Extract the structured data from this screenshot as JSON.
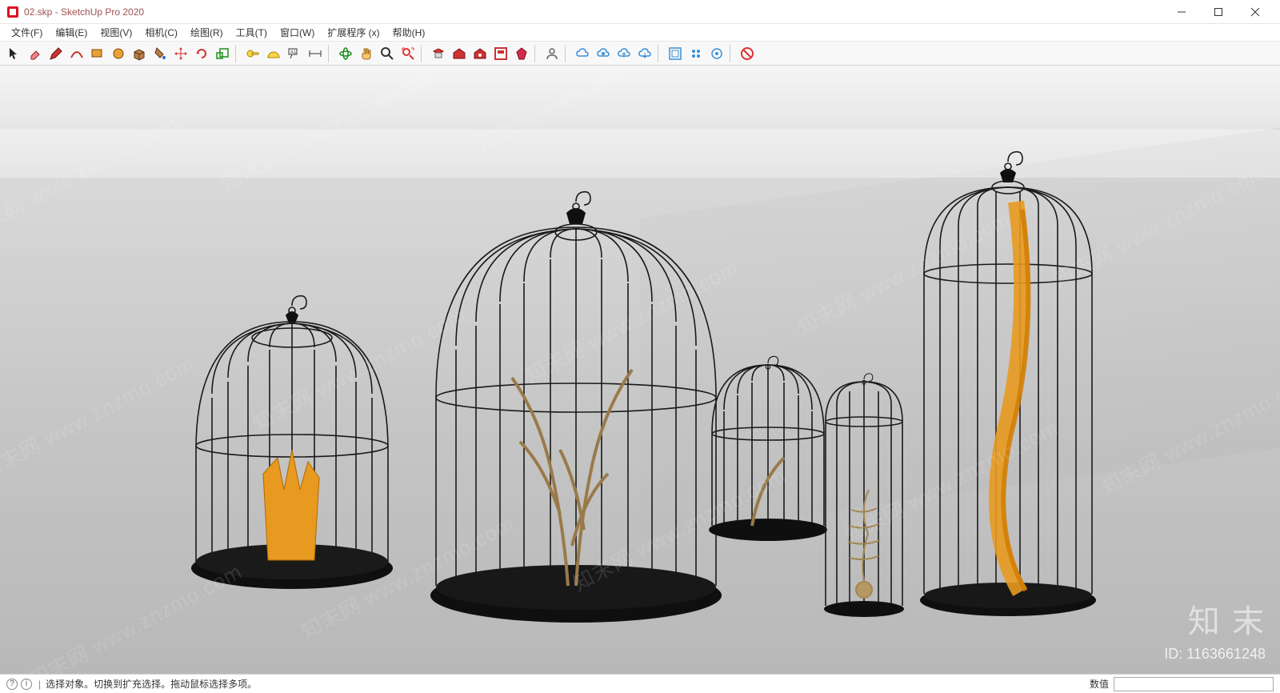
{
  "window": {
    "title": "02.skp - SketchUp Pro 2020"
  },
  "menu": {
    "file": "文件(F)",
    "edit": "编辑(E)",
    "view": "视图(V)",
    "camera": "相机(C)",
    "draw": "绘图(R)",
    "tools": "工具(T)",
    "window": "窗口(W)",
    "extensions": "扩展程序 (x)",
    "help": "帮助(H)"
  },
  "toolbar_icons": {
    "select": "select-icon",
    "eraser": "eraser-icon",
    "pencil": "pencil-icon",
    "arc": "arc-icon",
    "rectangle": "rectangle-icon",
    "pushpull": "pushpull-icon",
    "paint": "paint-icon",
    "move": "move-icon",
    "rotate": "rotate-icon",
    "scale": "scale-icon",
    "tape": "tape-icon",
    "text": "text-icon",
    "offset": "offset-icon",
    "orbit": "orbit-icon",
    "pan": "pan-icon",
    "zoom": "zoom-icon",
    "zoomext": "zoom-extents-icon",
    "warehouse": "warehouse-icon",
    "extension": "extension-warehouse-icon",
    "layout": "layout-icon",
    "ruby": "ruby-icon",
    "user": "user-icon",
    "cloud": "cloud-icon"
  },
  "status": {
    "hint": "选择对象。切换到扩充选择。拖动鼠标选择多项。",
    "measure_label": "数值"
  },
  "watermarks": {
    "diag": "知末网 www.znzmo.com",
    "logo": "知 末",
    "id_label": "ID: 1163661248"
  }
}
